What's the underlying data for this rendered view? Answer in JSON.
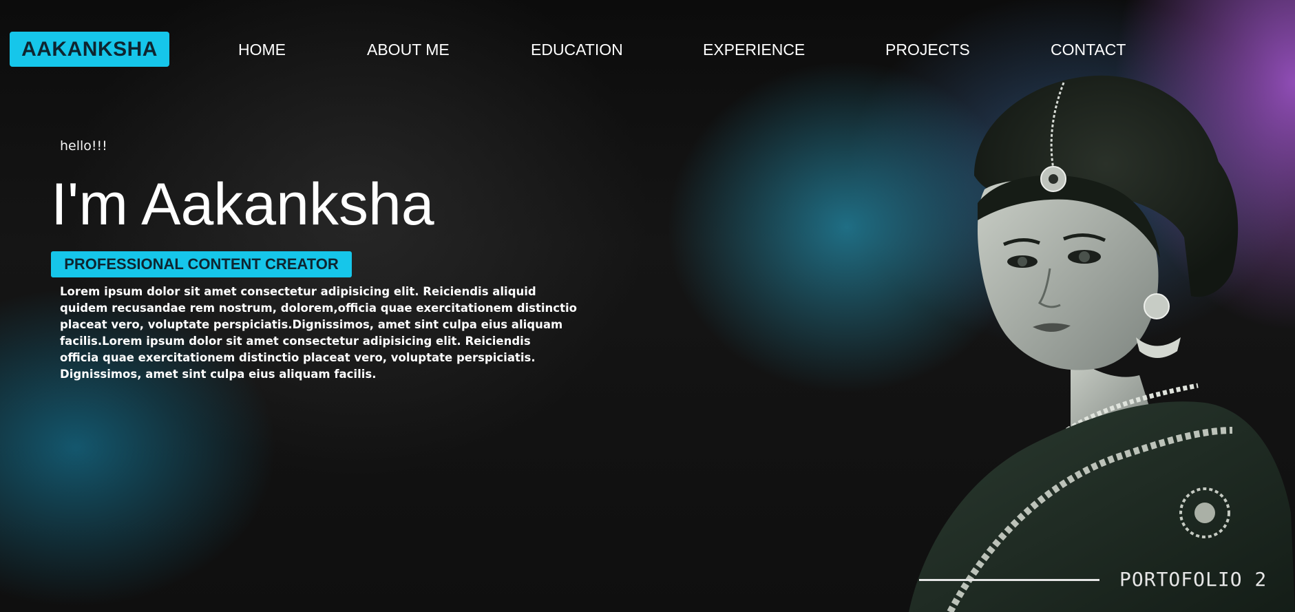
{
  "brand": {
    "logo_text": "AAKANKSHA",
    "accent_color": "#16c6ea"
  },
  "nav": {
    "items": [
      {
        "label": "HOME"
      },
      {
        "label": "ABOUT ME"
      },
      {
        "label": "EDUCATION"
      },
      {
        "label": "EXPERIENCE"
      },
      {
        "label": "PROJECTS"
      },
      {
        "label": "CONTACT"
      }
    ]
  },
  "hero": {
    "greeting": "hello!!!",
    "title": "I'm Aakanksha",
    "role": "PROFESSIONAL CONTENT CREATOR",
    "bio_lines": [
      "Lorem ipsum dolor sit amet consectetur adipisicing elit. Reiciendis aliquid",
      "quidem recusandae rem nostrum, dolorem,officia quae exercitationem distinctio",
      "placeat vero, voluptate perspiciatis.Dignissimos, amet sint culpa eius aliquam",
      "facilis.Lorem ipsum dolor sit amet consectetur adipisicing elit. Reiciendis",
      "officia quae exercitationem distinctio placeat vero, voluptate perspiciatis.",
      "Dignissimos, amet sint culpa eius aliquam facilis."
    ]
  },
  "footer": {
    "tag": "PORTOFOLIO 2"
  },
  "colors": {
    "background": "#121212",
    "glow_teal": "#238caa",
    "glow_purple": "#9650be"
  }
}
